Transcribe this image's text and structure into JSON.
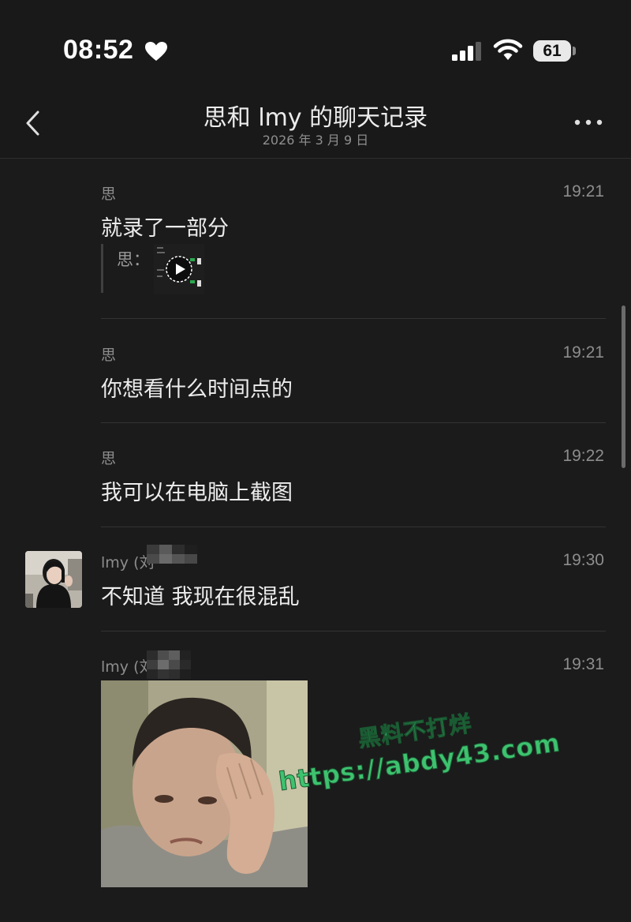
{
  "status_bar": {
    "time": "08:52",
    "battery": "61",
    "icons": [
      "heart-icon",
      "signal-icon",
      "wifi-icon",
      "battery-icon"
    ]
  },
  "header": {
    "title": "思和 lmy 的聊天记录",
    "subtitle": "2026 年 3 月 9 日",
    "icons": [
      "back-icon",
      "more-icon"
    ]
  },
  "messages": [
    {
      "sender": "思",
      "time": "19:21",
      "text": "就录了一部分",
      "quote_sender": "思："
    },
    {
      "sender": "思",
      "time": "19:21",
      "text": "你想看什么时间点的"
    },
    {
      "sender": "思",
      "time": "19:22",
      "text": "我可以在电脑上截图"
    },
    {
      "sender": "lmy (刘",
      "time": "19:30",
      "text": "不知道 我现在很混乱"
    },
    {
      "sender": "lmy (刘",
      "time": "19:31",
      "image": "meme-photo"
    }
  ],
  "watermark": {
    "line1": "黑料不打烊",
    "line2": "https://abdy43.com"
  },
  "colors": {
    "background": "#1b1b1b",
    "text": "#ececec",
    "muted": "#8d8d8d",
    "watermark": "#3ec26f"
  }
}
